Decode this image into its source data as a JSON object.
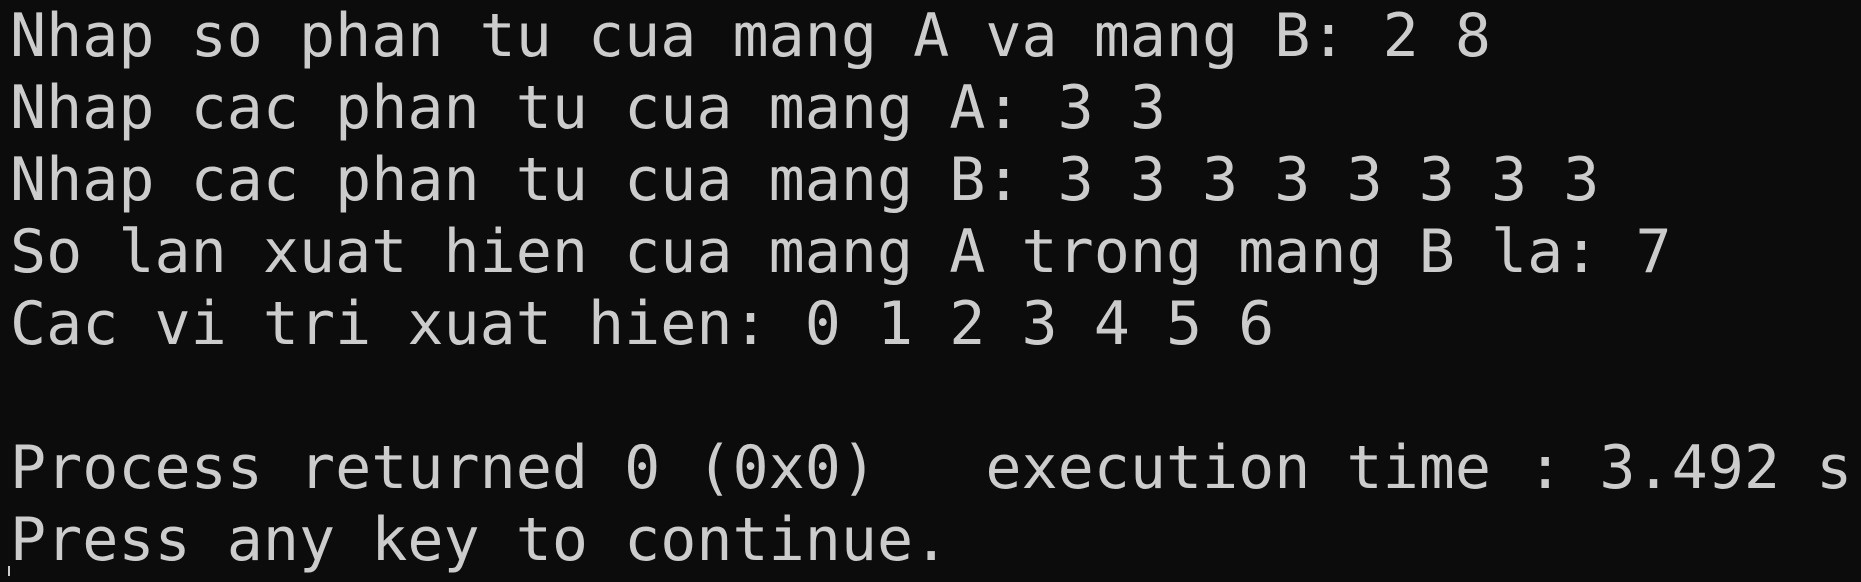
{
  "console": {
    "lines": [
      "Nhap so phan tu cua mang A va mang B: 2 8",
      "Nhap cac phan tu cua mang A: 3 3",
      "Nhap cac phan tu cua mang B: 3 3 3 3 3 3 3 3",
      "So lan xuat hien cua mang A trong mang B la: 7",
      "Cac vi tri xuat hien: 0 1 2 3 4 5 6",
      "",
      "Process returned 0 (0x0)   execution time : 3.492 s",
      "Press any key to continue."
    ]
  },
  "colors": {
    "background": "#0c0c0c",
    "text": "#cccccc"
  }
}
